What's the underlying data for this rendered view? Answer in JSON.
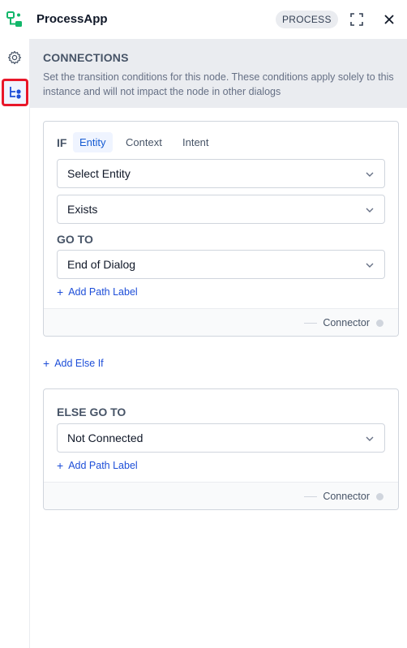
{
  "header": {
    "app_title": "ProcessApp",
    "badge": "PROCESS",
    "icons": [
      "app-logo-icon",
      "expand-icon",
      "close-icon"
    ]
  },
  "sidebar": {
    "items": [
      {
        "icon": "gear-icon",
        "active": false
      },
      {
        "icon": "connections-icon",
        "active": true
      }
    ]
  },
  "connections": {
    "title": "CONNECTIONS",
    "description": "Set the transition conditions for this node. These conditions apply solely to this instance and will not impact the node in other dialogs"
  },
  "if_card": {
    "if_label": "IF",
    "tabs": [
      "Entity",
      "Context",
      "Intent"
    ],
    "active_tab": "Entity",
    "entity_select": "Select Entity",
    "condition_select": "Exists",
    "goto_label": "GO TO",
    "goto_select": "End of Dialog",
    "add_path_label": "Add Path Label",
    "connector": "Connector"
  },
  "add_else_if": "Add Else If",
  "else_card": {
    "label": "ELSE GO TO",
    "select": "Not Connected",
    "add_path_label": "Add Path Label",
    "connector": "Connector"
  },
  "colors": {
    "accent": "#175cd3",
    "band": "#eaecf0",
    "highlight_border": "#e8172a",
    "logo": "#12b76a"
  }
}
